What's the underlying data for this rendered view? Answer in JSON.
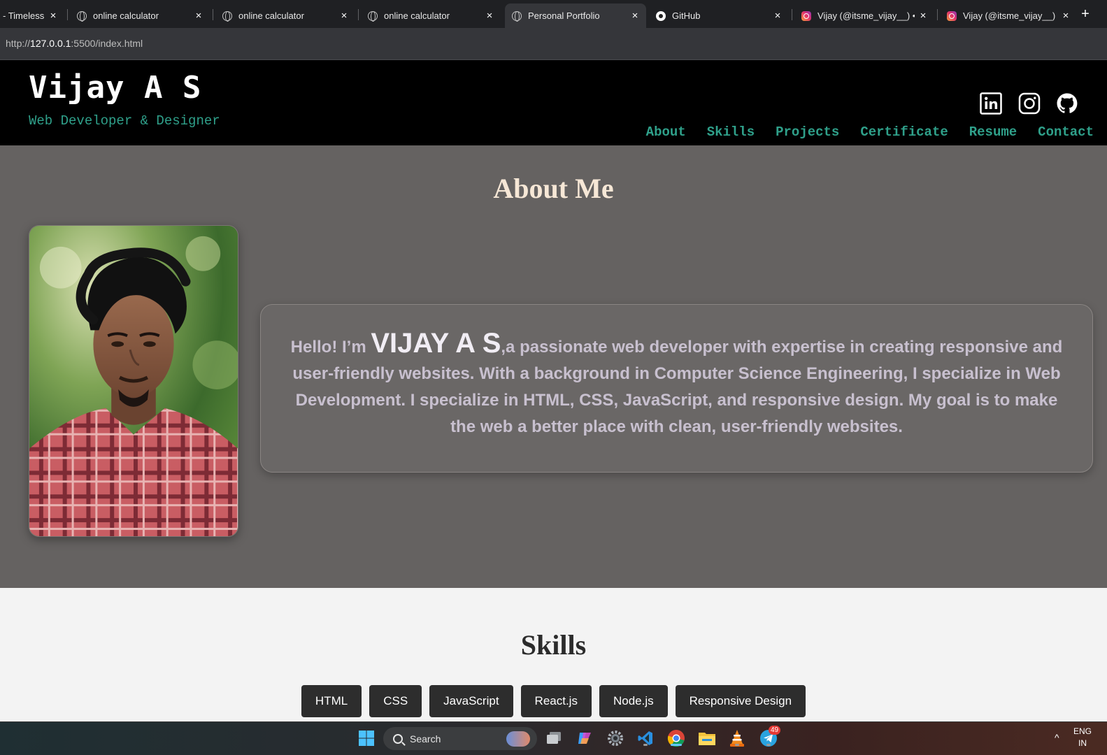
{
  "browser": {
    "tabs": [
      {
        "label": "- Timeless",
        "icon": "timeless-favicon",
        "close": "×"
      },
      {
        "label": "online calculator",
        "icon": "globe-icon",
        "close": "×"
      },
      {
        "label": "online calculator",
        "icon": "globe-icon",
        "close": "×"
      },
      {
        "label": "online calculator",
        "icon": "globe-icon",
        "close": "×"
      },
      {
        "label": "Personal Portfolio",
        "icon": "globe-icon",
        "close": "×",
        "active": true
      },
      {
        "label": "GitHub",
        "icon": "github-icon",
        "close": "×"
      },
      {
        "label": "Vijay (@itsme_vijay__) •",
        "icon": "instagram-icon",
        "close": "×"
      },
      {
        "label": "Vijay (@itsme_vijay__) •",
        "icon": "instagram-icon",
        "close": "×"
      }
    ],
    "new_tab": "+",
    "address": {
      "prefix": "http://",
      "host": "127.0.0.1",
      "rest": ":5500/index.html"
    }
  },
  "header": {
    "name": "Vijay A S",
    "tagline": "Web Developer & Designer",
    "social": [
      {
        "name": "linkedin",
        "icon": "linkedin-icon"
      },
      {
        "name": "instagram",
        "icon": "instagram-icon"
      },
      {
        "name": "github",
        "icon": "github-icon"
      }
    ],
    "nav": [
      "About",
      "Skills",
      "Projects",
      "Certificate",
      "Resume",
      "Contact"
    ]
  },
  "about": {
    "title": "About Me",
    "intro_prefix": "Hello! I’m ",
    "intro_name": "VIJAY A S",
    "intro_body": ",a passionate web developer with expertise in creating responsive and user-friendly websites. With a background in Computer Science Engineering, I specialize in Web Development. I specialize in HTML, CSS, JavaScript, and responsive design. My goal is to make the web a better place with clean, user-friendly websites."
  },
  "skills": {
    "title": "Skills",
    "items": [
      "HTML",
      "CSS",
      "JavaScript",
      "React.js",
      "Node.js",
      "Responsive Design"
    ]
  },
  "taskbar": {
    "search_label": "Search",
    "apps": [
      "windows-start-icon",
      "task-view-icon",
      "copilot-icon",
      "settings-icon",
      "vscode-icon",
      "chrome-icon",
      "file-explorer-icon",
      "vlc-icon",
      "telegram-icon"
    ],
    "telegram_badge": "49",
    "lang_line1": "ENG",
    "lang_line2": "IN",
    "tray_arrow": "^"
  },
  "colors": {
    "header_bg": "#000000",
    "accent_teal": "#2fa08a",
    "about_bg": "#656261",
    "about_title": "#f6e7d6",
    "skills_bg": "#f3f3f3",
    "chip_bg": "#2d2d2d"
  }
}
